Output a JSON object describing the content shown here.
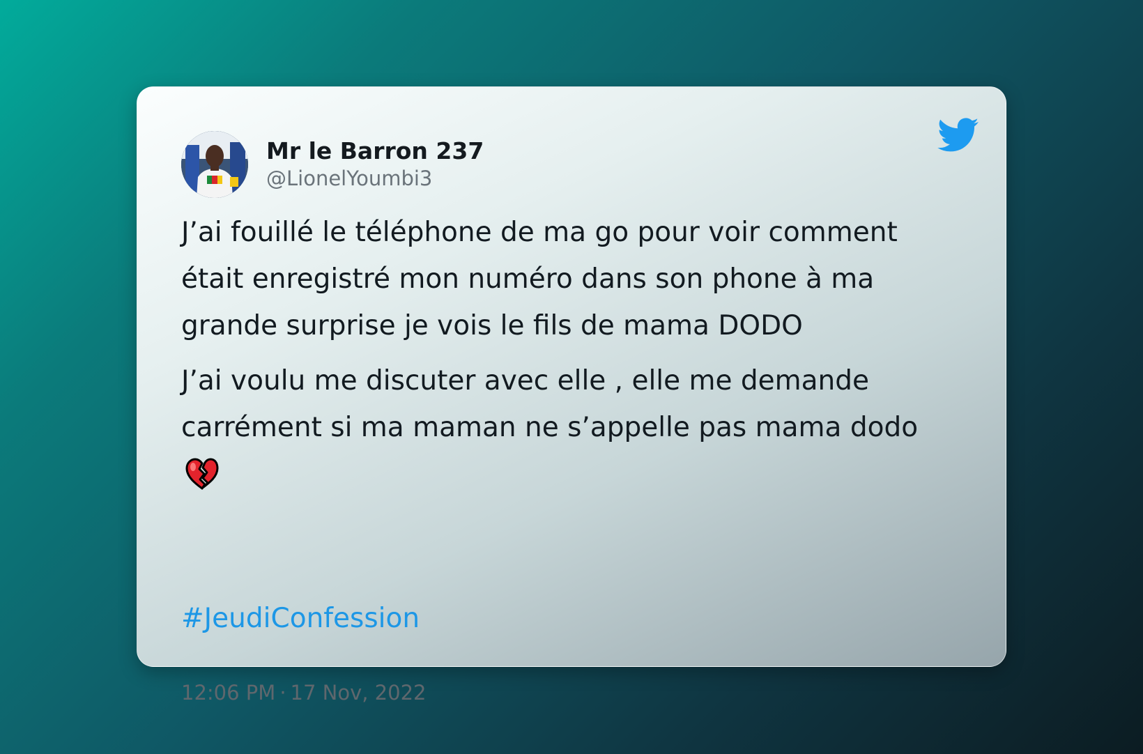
{
  "tweet": {
    "author_name": "Mr le Barron 237",
    "author_handle": "@LionelYoumbi3",
    "paragraphs": [
      "J’ai fouillé le téléphone de ma go pour voir comment était enregistré mon numéro dans son phone à ma grande surprise je vois le fils de mama DODO",
      "J’ai voulu me discuter avec elle , elle me demande carrément si ma maman ne s’appelle pas mama dodo"
    ],
    "emoji_icon": "broken-heart-icon",
    "hashtag": "#JeudiConfession",
    "time": "12:06 PM",
    "separator": "·",
    "date": "17 Nov, 2022"
  },
  "icons": {
    "brand": "twitter-bird-icon"
  },
  "colors": {
    "twitter_blue": "#1d9bf0",
    "hashtag": "#1d97e6",
    "handle": "#6a737a",
    "broken_heart": "#e3232c"
  }
}
